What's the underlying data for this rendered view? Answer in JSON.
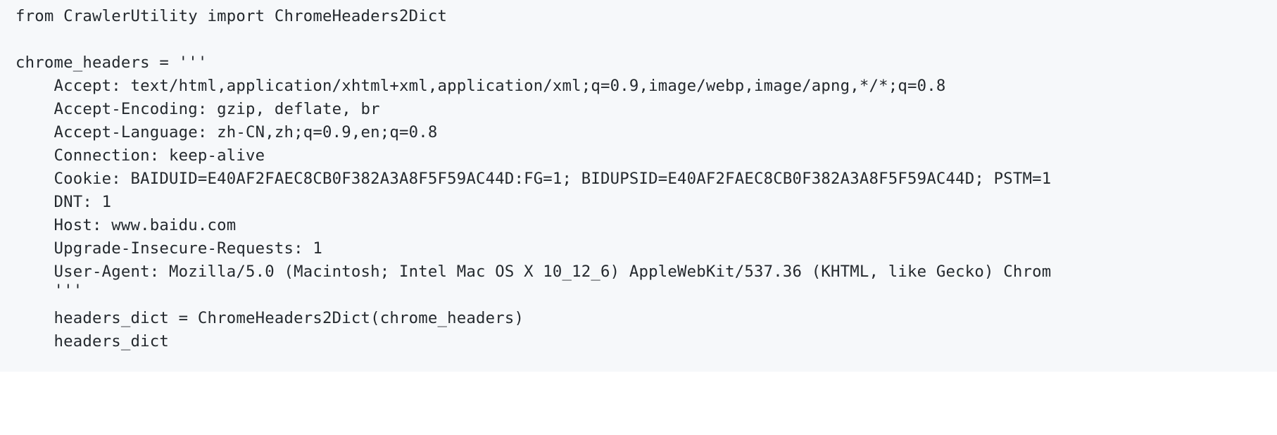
{
  "code": {
    "language": "python",
    "lines": [
      "from CrawlerUtility import ChromeHeaders2Dict",
      "chrome_headers = '''",
      "    Accept: text/html,application/xhtml+xml,application/xml;q=0.9,image/webp,image/apng,*/*;q=0.8",
      "    Accept-Encoding: gzip, deflate, br",
      "    Accept-Language: zh-CN,zh;q=0.9,en;q=0.8",
      "    Connection: keep-alive",
      "    Cookie: BAIDUID=E40AF2FAEC8CB0F382A3A8F5F59AC44D:FG=1; BIDUPSID=E40AF2FAEC8CB0F382A3A8F5F59AC44D; PSTM=1",
      "    DNT: 1",
      "    Host: www.baidu.com",
      "    Upgrade-Insecure-Requests: 1",
      "    User-Agent: Mozilla/5.0 (Macintosh; Intel Mac OS X 10_12_6) AppleWebKit/537.36 (KHTML, like Gecko) Chrom",
      "    '''",
      "    headers_dict = ChromeHeaders2Dict(chrome_headers)",
      "    headers_dict"
    ]
  },
  "colors": {
    "background": "#f6f8fa",
    "text": "#24292e"
  }
}
